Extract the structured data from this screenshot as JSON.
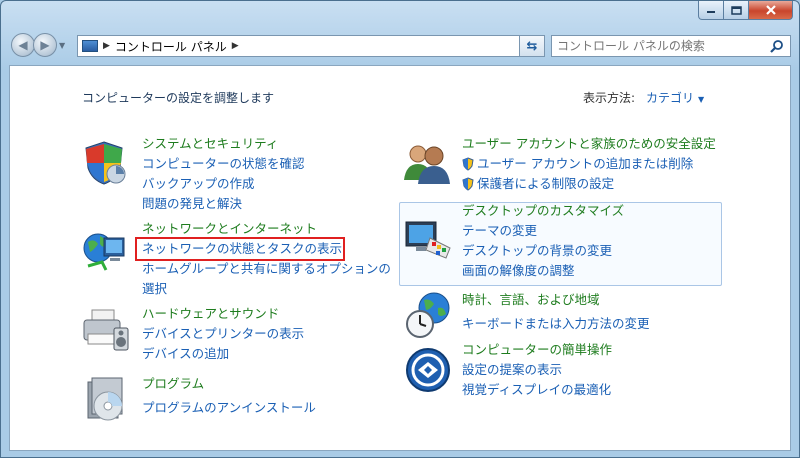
{
  "window": {
    "address_segment": "コントロール パネル"
  },
  "search": {
    "placeholder": "コントロール パネルの検索"
  },
  "header": {
    "title": "コンピューターの設定を調整します",
    "view_by_label": "表示方法:",
    "view_by_value": "カテゴリ"
  },
  "categories": [
    {
      "title": "システムとセキュリティ",
      "icon": "shield-icon",
      "links": [
        "コンピューターの状態を確認",
        "バックアップの作成",
        "問題の発見と解決"
      ]
    },
    {
      "title": "ネットワークとインターネット",
      "icon": "network-globe-icon",
      "links": [
        "ネットワークの状態とタスクの表示",
        "ホームグループと共有に関するオプションの",
        "選択"
      ]
    },
    {
      "title": "ハードウェアとサウンド",
      "icon": "printer-icon",
      "links": [
        "デバイスとプリンターの表示",
        "デバイスの追加"
      ]
    },
    {
      "title": "プログラム",
      "icon": "programs-disc-icon",
      "links": [
        "プログラムのアンインストール"
      ]
    },
    {
      "title": "ユーザー アカウントと家族のための安全設定",
      "icon": "users-icon",
      "links": [
        "ユーザー アカウントの追加または削除",
        "保護者による制限の設定"
      ]
    },
    {
      "title": "デスクトップのカスタマイズ",
      "icon": "monitor-palette-icon",
      "links": [
        "テーマの変更",
        "デスクトップの背景の変更",
        "画面の解像度の調整"
      ]
    },
    {
      "title": "時計、言語、および地域",
      "icon": "clock-globe-icon",
      "links": [
        "キーボードまたは入力方法の変更"
      ]
    },
    {
      "title": "コンピューターの簡単操作",
      "icon": "ease-of-access-icon",
      "links": [
        "設定の提案の表示",
        "視覚ディスプレイの最適化"
      ]
    }
  ],
  "colors": {
    "highlight": "#e02020",
    "link": "#1a5fb4",
    "category": "#1e7c1e"
  }
}
